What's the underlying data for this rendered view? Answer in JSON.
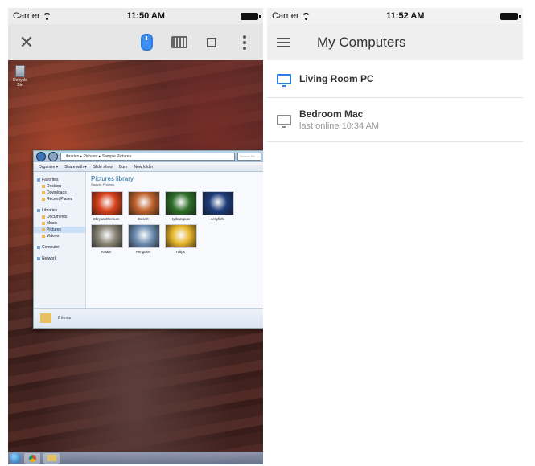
{
  "left": {
    "status": {
      "carrier": "Carrier",
      "time": "11:50 AM"
    },
    "desktop": {
      "recycle_label": "Recycle Bin",
      "explorer": {
        "address": "Libraries ▸ Pictures ▸ Sample Pictures",
        "search_placeholder": "Search Sa",
        "commands": [
          "Organize ▾",
          "Share with ▾",
          "Slide show",
          "Burn",
          "New folder"
        ],
        "sidebar": [
          {
            "label": "Favorites",
            "indent": false
          },
          {
            "label": "Desktop",
            "indent": true
          },
          {
            "label": "Downloads",
            "indent": true
          },
          {
            "label": "Recent Places",
            "indent": true
          },
          {
            "label": "Libraries",
            "indent": false,
            "gap": true
          },
          {
            "label": "Documents",
            "indent": true
          },
          {
            "label": "Music",
            "indent": true
          },
          {
            "label": "Pictures",
            "indent": true,
            "selected": true
          },
          {
            "label": "Videos",
            "indent": true
          },
          {
            "label": "Computer",
            "indent": false,
            "gap": true
          },
          {
            "label": "Network",
            "indent": false,
            "gap": true
          }
        ],
        "library_title": "Pictures library",
        "library_sub": "Sample Pictures",
        "pictures": [
          {
            "label": "Chrysanthemum",
            "color": "#d8421c"
          },
          {
            "label": "Desert",
            "color": "#c0632c"
          },
          {
            "label": "Hydrangeas",
            "color": "#2f6f2a"
          },
          {
            "label": "Jellyfish",
            "color": "#1d3c7a"
          },
          {
            "label": "Koala",
            "color": "#8b8676"
          },
          {
            "label": "Penguins",
            "color": "#6f8fb3"
          },
          {
            "label": "Tulips",
            "color": "#e7b52a"
          }
        ],
        "status_count": "8 items"
      }
    }
  },
  "right": {
    "status": {
      "carrier": "Carrier",
      "time": "11:52 AM"
    },
    "title": "My Computers",
    "computers": [
      {
        "name": "Living Room PC",
        "status": "",
        "online": true
      },
      {
        "name": "Bedroom Mac",
        "status": "last online 10:34 AM",
        "online": false
      }
    ]
  },
  "colors": {
    "accent": "#2e7de0",
    "offline": "#8a8a8a"
  }
}
